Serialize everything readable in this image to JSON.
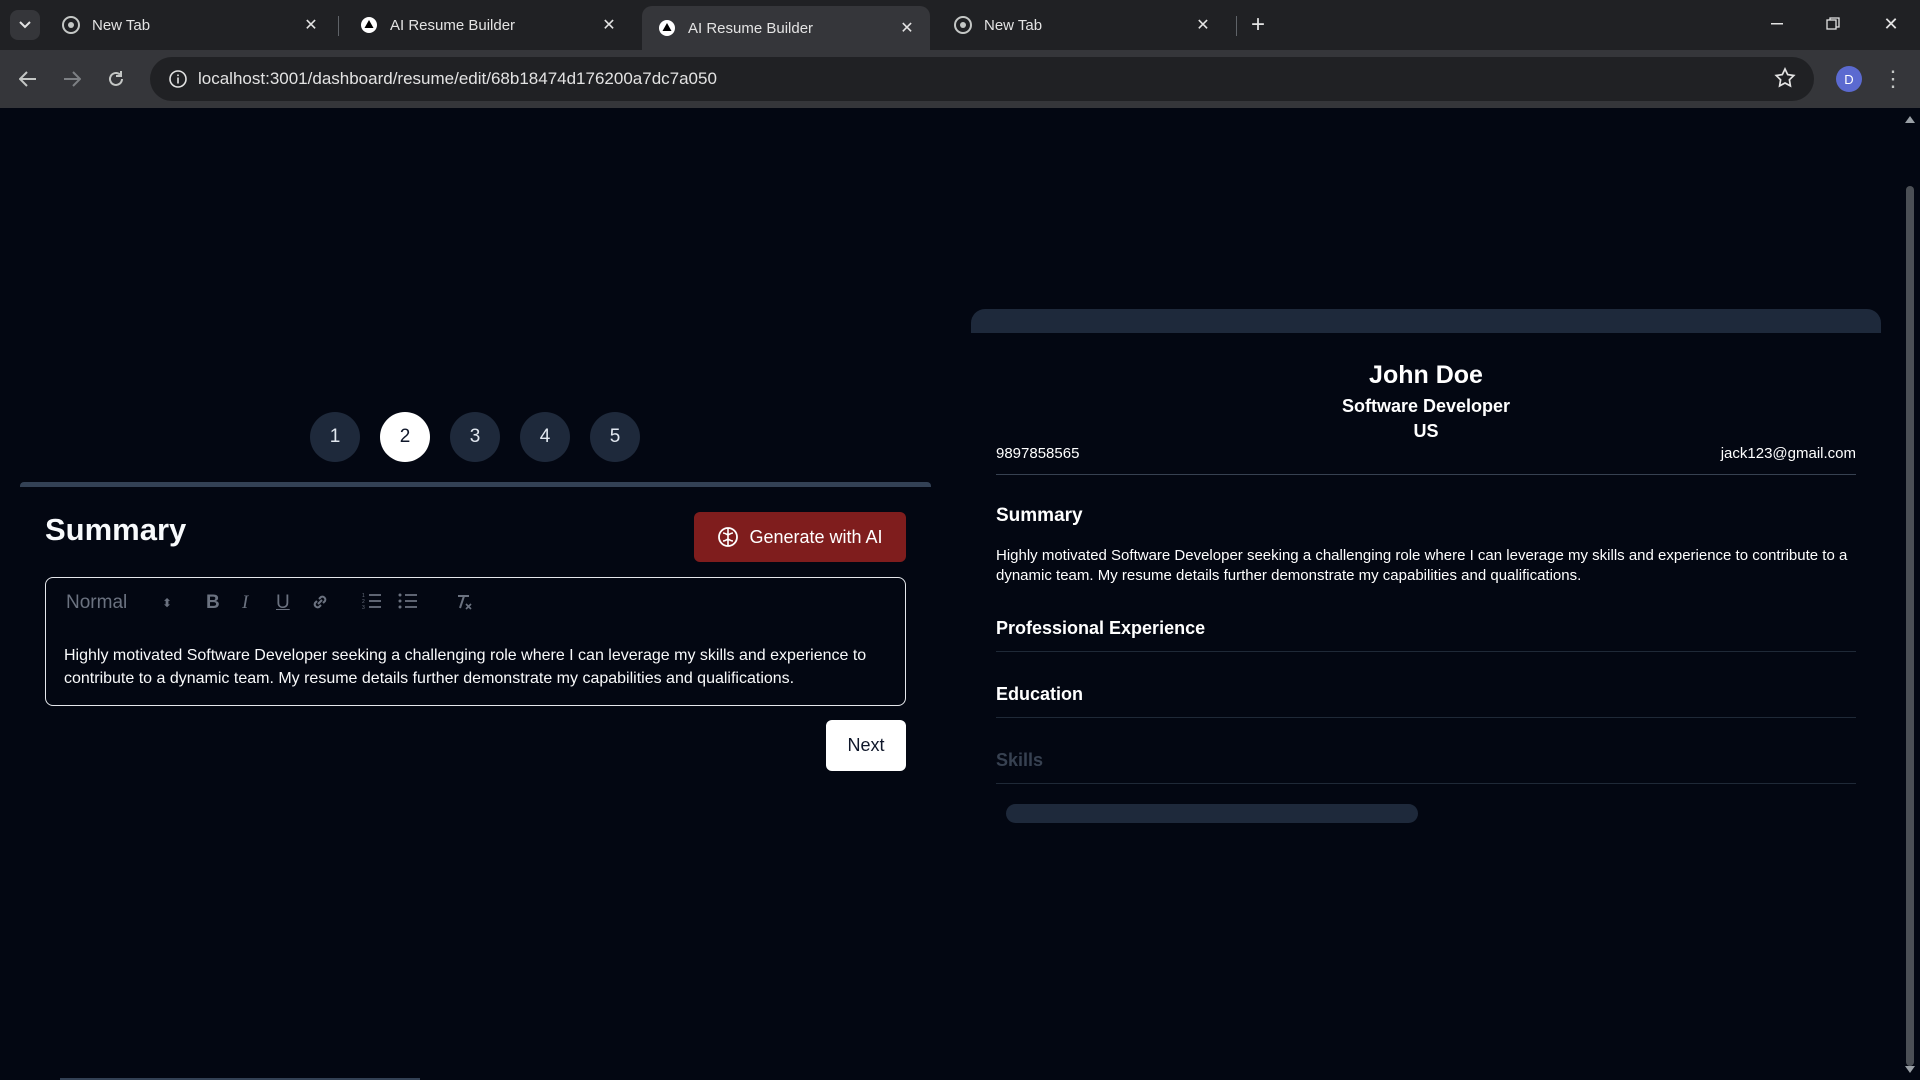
{
  "browser": {
    "tabs": [
      {
        "title": "New Tab",
        "favicon": "chrome-icon",
        "active": false
      },
      {
        "title": "AI Resume Builder",
        "favicon": "triangle-logo-icon",
        "active": false
      },
      {
        "title": "AI Resume Builder",
        "favicon": "triangle-logo-icon",
        "active": true
      },
      {
        "title": "New Tab",
        "favicon": "chrome-icon",
        "active": false
      }
    ],
    "url": "localhost:3001/dashboard/resume/edit/68b18474d176200a7dc7a050",
    "profile_initial": "D"
  },
  "steps": {
    "items": [
      "1",
      "2",
      "3",
      "4",
      "5"
    ],
    "active_index": 1
  },
  "form": {
    "section_title": "Summary",
    "generate_label": "Generate with AI",
    "toolbar": {
      "style_select": "Normal"
    },
    "content": "Highly motivated Software Developer seeking a challenging role where I can leverage my skills and experience to contribute to a dynamic team. My resume details further demonstrate my capabilities and qualifications.",
    "next_label": "Next"
  },
  "preview": {
    "name": "John Doe",
    "job_title": "Software Developer",
    "location": "US",
    "phone": "9897858565",
    "email": "jack123@gmail.com",
    "summary_heading": "Summary",
    "summary_text": "Highly motivated Software Developer seeking a challenging role where I can leverage my skills and experience to contribute to a dynamic team. My resume details further demonstrate my capabilities and qualifications.",
    "experience_heading": "Professional Experience",
    "education_heading": "Education",
    "skills_heading": "Skills"
  },
  "colors": {
    "page_bg": "#030712",
    "accent_red": "#7f1d1d",
    "step_inactive": "#1e293b"
  }
}
